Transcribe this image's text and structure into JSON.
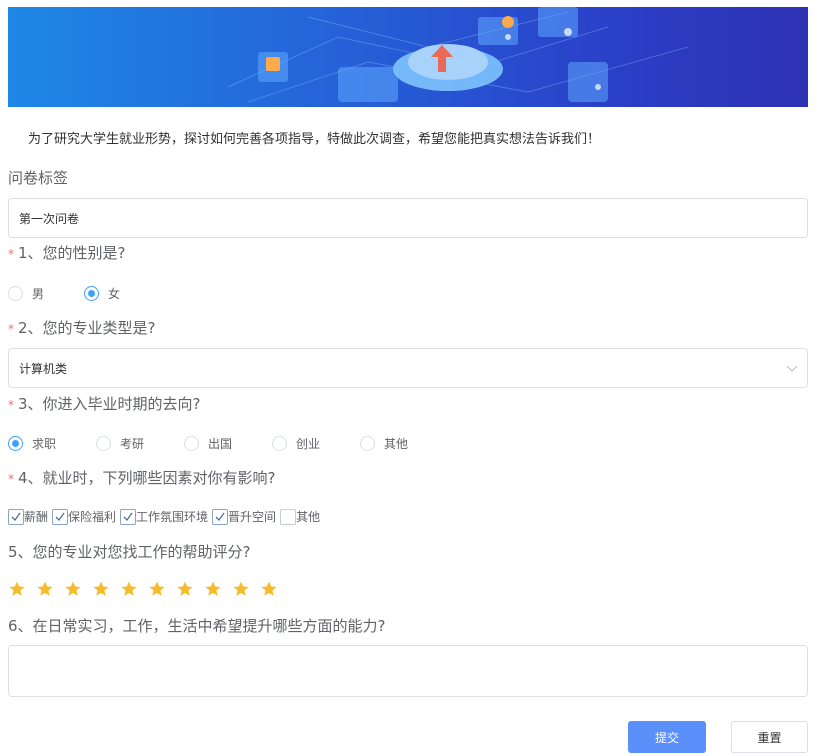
{
  "intro": "为了研究大学生就业形势，探讨如何完善各项指导，特做此次调查，希望您能把真实想法告诉我们！",
  "tag": {
    "label": "问卷标签",
    "value": "第一次问卷"
  },
  "questions": {
    "q1": {
      "required_mark": "*",
      "label": "1、您的性别是?",
      "options": [
        "男",
        "女"
      ],
      "selected": "女"
    },
    "q2": {
      "required_mark": "*",
      "label": "2、您的专业类型是?",
      "selected": "计算机类"
    },
    "q3": {
      "required_mark": "*",
      "label": "3、你进入毕业时期的去向?",
      "options": [
        "求职",
        "考研",
        "出国",
        "创业",
        "其他"
      ],
      "selected": "求职"
    },
    "q4": {
      "required_mark": "*",
      "label": "4、就业时，下列哪些因素对你有影响?",
      "options": [
        "薪酬",
        "保险福利",
        "工作氛围环境",
        "晋升空间",
        "其他"
      ],
      "checked": [
        true,
        true,
        true,
        true,
        false
      ]
    },
    "q5": {
      "label": "5、您的专业对您找工作的帮助评分?",
      "rating": 10,
      "max": 10
    },
    "q6": {
      "label": "6、在日常实习，工作，生活中希望提升哪些方面的能力?",
      "value": ""
    }
  },
  "buttons": {
    "submit": "提交",
    "reset": "重置"
  },
  "colors": {
    "accent": "#409eff",
    "required": "#f56c6c",
    "star": "#f7ba2a",
    "submit_bg": "#5b8ff9"
  },
  "icons": {
    "select_arrow": "chevron-down-icon",
    "star": "star-icon",
    "check": "check-icon"
  }
}
